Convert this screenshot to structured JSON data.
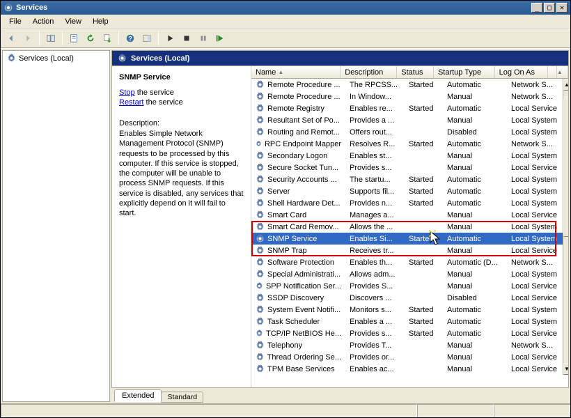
{
  "window": {
    "title": "Services"
  },
  "menu": {
    "file": "File",
    "action": "Action",
    "view": "View",
    "help": "Help"
  },
  "tree": {
    "root": "Services (Local)"
  },
  "band": {
    "title": "Services (Local)"
  },
  "detail": {
    "service_name": "SNMP Service",
    "stop": "Stop",
    "stop_suffix": " the service",
    "restart": "Restart",
    "restart_suffix": " the service",
    "desc_label": "Description:",
    "desc_text": "Enables Simple Network Management Protocol (SNMP) requests to be processed by this computer. If this service is stopped, the computer will be unable to process SNMP requests. If this service is disabled, any services that explicitly depend on it will fail to start."
  },
  "columns": {
    "name": "Name",
    "description": "Description",
    "status": "Status",
    "startup": "Startup Type",
    "logon": "Log On As"
  },
  "tabs": {
    "extended": "Extended",
    "standard": "Standard"
  },
  "rows": [
    {
      "name": "Remote Procedure ...",
      "desc": "The RPCSS...",
      "status": "Started",
      "startup": "Automatic",
      "logon": "Network S..."
    },
    {
      "name": "Remote Procedure ...",
      "desc": "In Window...",
      "status": "",
      "startup": "Manual",
      "logon": "Network S..."
    },
    {
      "name": "Remote Registry",
      "desc": "Enables re...",
      "status": "Started",
      "startup": "Automatic",
      "logon": "Local Service"
    },
    {
      "name": "Resultant Set of Po...",
      "desc": "Provides a ...",
      "status": "",
      "startup": "Manual",
      "logon": "Local System"
    },
    {
      "name": "Routing and Remot...",
      "desc": "Offers rout...",
      "status": "",
      "startup": "Disabled",
      "logon": "Local System"
    },
    {
      "name": "RPC Endpoint Mapper",
      "desc": "Resolves R...",
      "status": "Started",
      "startup": "Automatic",
      "logon": "Network S..."
    },
    {
      "name": "Secondary Logon",
      "desc": "Enables st...",
      "status": "",
      "startup": "Manual",
      "logon": "Local System"
    },
    {
      "name": "Secure Socket Tun...",
      "desc": "Provides s...",
      "status": "",
      "startup": "Manual",
      "logon": "Local Service"
    },
    {
      "name": "Security Accounts ...",
      "desc": "The startu...",
      "status": "Started",
      "startup": "Automatic",
      "logon": "Local System"
    },
    {
      "name": "Server",
      "desc": "Supports fil...",
      "status": "Started",
      "startup": "Automatic",
      "logon": "Local System"
    },
    {
      "name": "Shell Hardware Det...",
      "desc": "Provides n...",
      "status": "Started",
      "startup": "Automatic",
      "logon": "Local System"
    },
    {
      "name": "Smart Card",
      "desc": "Manages a...",
      "status": "",
      "startup": "Manual",
      "logon": "Local Service"
    },
    {
      "name": "Smart Card Remov...",
      "desc": "Allows the ...",
      "status": "",
      "startup": "Manual",
      "logon": "Local System"
    },
    {
      "name": "SNMP Service",
      "desc": "Enables Si...",
      "status": "Started",
      "startup": "Automatic",
      "logon": "Local System",
      "selected": true
    },
    {
      "name": "SNMP Trap",
      "desc": "Receives tr...",
      "status": "",
      "startup": "Manual",
      "logon": "Local Service"
    },
    {
      "name": "Software Protection",
      "desc": "Enables th...",
      "status": "Started",
      "startup": "Automatic (D...",
      "logon": "Network S..."
    },
    {
      "name": "Special Administrati...",
      "desc": "Allows adm...",
      "status": "",
      "startup": "Manual",
      "logon": "Local System"
    },
    {
      "name": "SPP Notification Ser...",
      "desc": "Provides S...",
      "status": "",
      "startup": "Manual",
      "logon": "Local Service"
    },
    {
      "name": "SSDP Discovery",
      "desc": "Discovers ...",
      "status": "",
      "startup": "Disabled",
      "logon": "Local Service"
    },
    {
      "name": "System Event Notifi...",
      "desc": "Monitors s...",
      "status": "Started",
      "startup": "Automatic",
      "logon": "Local System"
    },
    {
      "name": "Task Scheduler",
      "desc": "Enables a ...",
      "status": "Started",
      "startup": "Automatic",
      "logon": "Local System"
    },
    {
      "name": "TCP/IP NetBIOS He...",
      "desc": "Provides s...",
      "status": "Started",
      "startup": "Automatic",
      "logon": "Local Service"
    },
    {
      "name": "Telephony",
      "desc": "Provides T...",
      "status": "",
      "startup": "Manual",
      "logon": "Network S..."
    },
    {
      "name": "Thread Ordering Se...",
      "desc": "Provides or...",
      "status": "",
      "startup": "Manual",
      "logon": "Local Service"
    },
    {
      "name": "TPM Base Services",
      "desc": "Enables ac...",
      "status": "",
      "startup": "Manual",
      "logon": "Local Service"
    }
  ]
}
